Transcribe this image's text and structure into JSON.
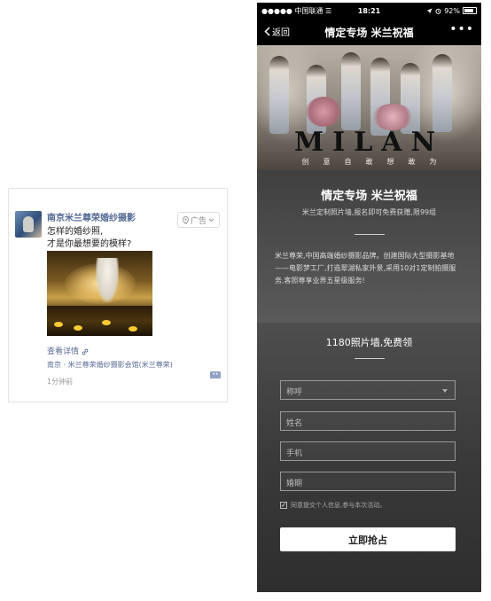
{
  "ad_card": {
    "advertiser": "南京米兰尊荣婚纱摄影",
    "ad_badge": "广告",
    "ad_badge_icon": "location-pin-icon",
    "text_line1": "怎样的婚纱照,",
    "text_line2": "才是你最想要的模样?",
    "details_link": "查看详情",
    "location": "南京 · 米兰尊荣婚纱摄影会馆(米兰尊荣)",
    "time_ago": "1分钟前"
  },
  "status_bar": {
    "carrier": "●●●●● 中国联通 ☰",
    "time": "18:21",
    "battery_percent": "92%",
    "icons": [
      "location-arrow-icon",
      "alarm-icon"
    ]
  },
  "navbar": {
    "back_label": "返回",
    "title": "情定专场 米兰祝福",
    "more_label": "•••"
  },
  "banner": {
    "brand": "MILAN",
    "slogan": "创意自敢想敢为"
  },
  "intro": {
    "title": "情定专场 米兰祝福",
    "subtitle": "米兰定制照片墙,报名即可免费获赠,限99组",
    "description": "米兰尊荣,中国高端婚纱摄影品牌。创建国际大型摄影基地——电影梦工厂,打造翠湖私家外景,采用10对1定制拍摄服务,客照尊享业界五星级服务!"
  },
  "form": {
    "title": "1180照片墙,免费领",
    "fields": {
      "salutation": "称呼",
      "name": "姓名",
      "phone": "手机",
      "wedding_date": "婚期"
    },
    "agree_text": "同意提交个人信息,参与本次活动。",
    "submit_label": "立即抢占"
  },
  "colors": {
    "link_blue": "#576b95",
    "page_dark": "#262626",
    "button_white": "#ffffff"
  }
}
